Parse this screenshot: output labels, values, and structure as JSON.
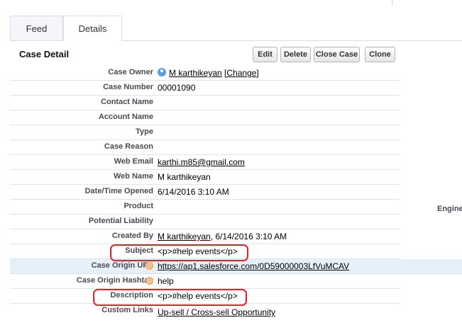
{
  "tabs": {
    "feed": "Feed",
    "details": "Details"
  },
  "section": {
    "title": "Case Detail"
  },
  "buttons": {
    "edit": "Edit",
    "delete": "Delete",
    "close_case": "Close Case",
    "clone": "Clone"
  },
  "fields": {
    "case_owner": {
      "label": "Case Owner",
      "name": "M karthikeyan",
      "change": "[Change]"
    },
    "case_number": {
      "label": "Case Number",
      "value": "00001090"
    },
    "contact_name": {
      "label": "Contact Name",
      "value": ""
    },
    "account_name": {
      "label": "Account Name",
      "value": ""
    },
    "type": {
      "label": "Type",
      "value": ""
    },
    "case_reason": {
      "label": "Case Reason",
      "value": ""
    },
    "web_email": {
      "label": "Web Email",
      "value": "karthi.m85@gmail.com"
    },
    "web_name": {
      "label": "Web Name",
      "value": "M karthikeyan"
    },
    "date_opened": {
      "label": "Date/Time Opened",
      "value": "6/14/2016 3:10 AM"
    },
    "product": {
      "label": "Product",
      "value": ""
    },
    "potential_liability": {
      "label": "Potential Liability",
      "value": ""
    },
    "created_by": {
      "label": "Created By",
      "name": "M karthikeyan",
      "date": ", 6/14/2016 3:10 AM"
    },
    "subject": {
      "label": "Subject",
      "value": "<p>#help events</p>"
    },
    "case_origin_url": {
      "label": "Case Origin URL",
      "value": "https://ap1.salesforce.com/0D59000003LfVuMCAV"
    },
    "case_origin_hashtag": {
      "label": "Case Origin Hashtag",
      "value": "help"
    },
    "description": {
      "label": "Description",
      "value": "<p>#help events</p>"
    },
    "custom_links": {
      "label": "Custom Links",
      "value": "Up-sell / Cross-sell Opportunity"
    }
  },
  "right_column": {
    "engine_label": "Engine"
  },
  "colors": {
    "highlight_box": "#e0242a",
    "hover_row": "#e6f0f8"
  }
}
